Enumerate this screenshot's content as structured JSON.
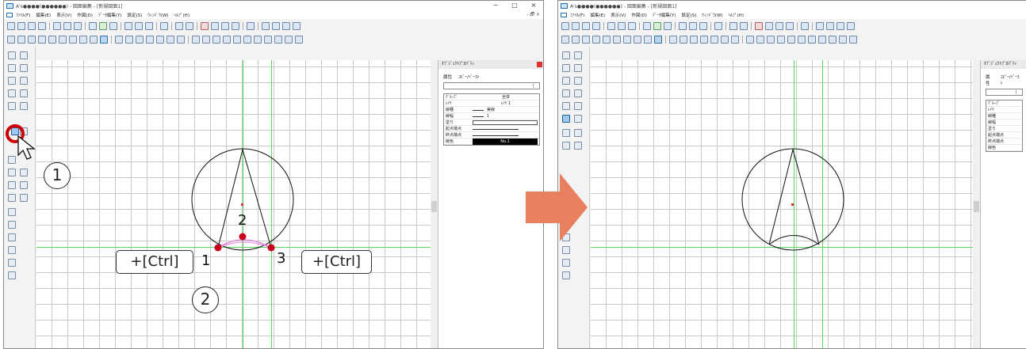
{
  "window": {
    "title": "A's●●●●(●●●●●●) - 図面編集 - [新規図面1]",
    "controls": [
      "−",
      "□",
      "×"
    ]
  },
  "menubar": {
    "items": [
      "ﾌｧｲﾙ(F)",
      "編集(E)",
      "表示(V)",
      "作図(D)",
      "ﾃﾞｰﾀ編集(Y)",
      "設定(S)",
      "ｳｨﾝﾄﾞｳ(W)",
      "ﾍﾙﾌﾟ(H)"
    ],
    "mdi_controls": "- 🗗 ×"
  },
  "panel": {
    "title": "ｵﾌﾞｼﾞｪｸﾄﾌﾟﾛﾊﾟﾃｨ",
    "tabs": [
      "属性",
      "ｺﾋﾟｰ/ﾍﾟｰｽﾄ"
    ],
    "rows": [
      {
        "key": "ｸﾞﾙｰﾌﾟ",
        "value": "全体"
      },
      {
        "key": "ﾚｲﾔ",
        "value": "ﾚｲﾔ 1"
      },
      {
        "key": "線種",
        "value": "実線"
      },
      {
        "key": "線幅",
        "value": "1"
      },
      {
        "key": "塗り",
        "value": ""
      },
      {
        "key": "起点端点",
        "value": ""
      },
      {
        "key": "終点端点",
        "value": ""
      },
      {
        "key": "線色",
        "value": "No.1"
      }
    ],
    "accent_color": "#e03030"
  },
  "annotations": {
    "step1": "1",
    "step2": "2",
    "ctrl_left": "+[Ctrl]",
    "ctrl_right": "+[Ctrl]",
    "point1": "1",
    "point2": "2",
    "point3": "3",
    "highlight_color": "#cc0000",
    "arrow_color": "#e8805f",
    "guide_color": "#5cd65c"
  }
}
